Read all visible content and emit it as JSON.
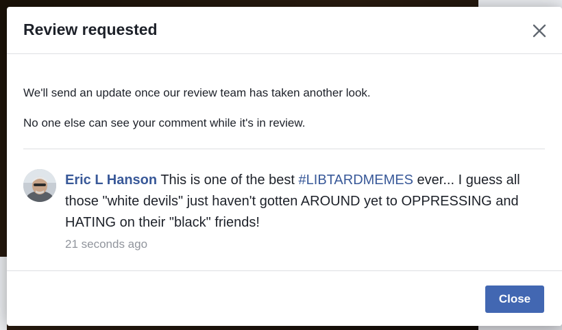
{
  "dialog": {
    "title": "Review requested",
    "message_line_1": "We'll send an update once our review team has taken another look.",
    "message_line_2": "No one else can see your comment while it's in review.",
    "close_icon": "close-icon"
  },
  "comment": {
    "author": "Eric L Hanson",
    "text_before": " This is one of the best ",
    "hashtag": "#LIBTARDMEMES",
    "text_after": " ever... I guess all those \"white devils\" just haven't gotten AROUND yet to OPPRESSING and HATING on their \"black\" friends!",
    "timestamp": "21 seconds ago"
  },
  "footer": {
    "close_label": "Close"
  },
  "colors": {
    "accent": "#4267b2",
    "link": "#385898",
    "text": "#1d2129",
    "muted": "#90949c",
    "divider": "#dddfe2"
  }
}
